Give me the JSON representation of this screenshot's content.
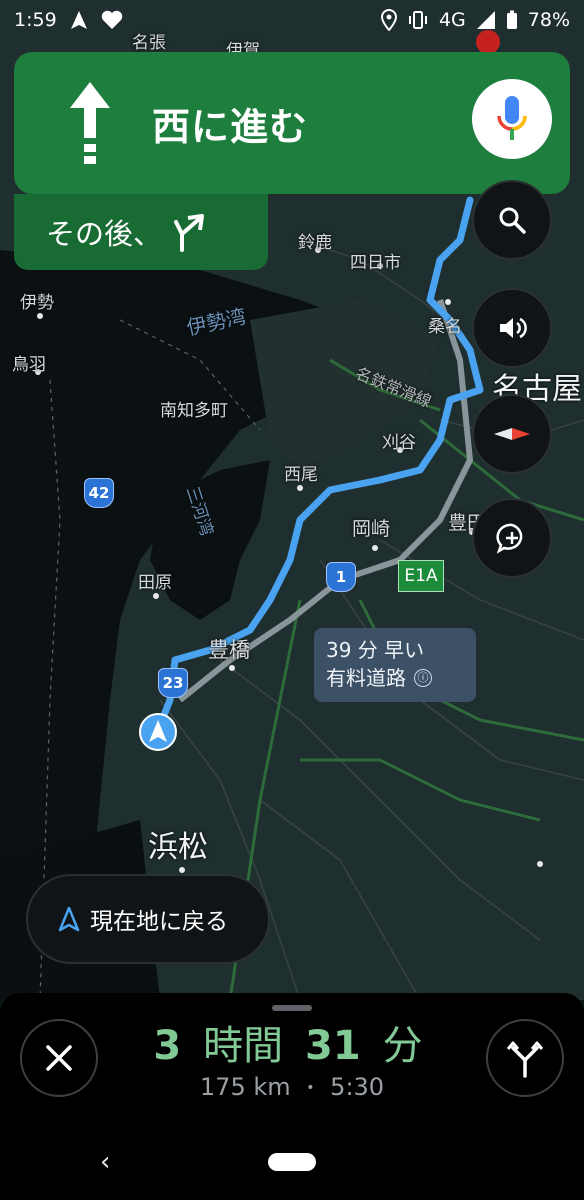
{
  "status_bar": {
    "time": "1:59",
    "network": "4G",
    "battery": "78%"
  },
  "nav": {
    "instruction": "西に進む",
    "then_label": "その後、",
    "colors": {
      "primary": "#1e7e3e",
      "secondary": "#186b33",
      "route": "#4aa3f0"
    }
  },
  "map": {
    "labels": {
      "nabari": "名張",
      "iga": "伊賀",
      "suzuka": "鈴鹿",
      "yokkaichi": "四日市",
      "ise": "伊勢",
      "kuwana": "桑名",
      "toba": "鳥羽",
      "ise_bay": "伊勢湾",
      "nagoya": "名古屋",
      "meitetsu_line": "名鉄常滑線",
      "minamichita": "南知多町",
      "kariya": "刈谷",
      "nishio": "西尾",
      "okazaki": "岡崎",
      "toyota": "豊田",
      "mikawa_bay": "三河湾",
      "tahara": "田原",
      "toyohashi": "豊橋",
      "hamamatsu": "浜松"
    },
    "shields": {
      "route42": "42",
      "route1": "1",
      "route23": "23",
      "expressway": "E1A"
    },
    "callout": {
      "line1": "39 分 早い",
      "line2": "有料道路"
    }
  },
  "recenter": {
    "label": "現在地に戻る"
  },
  "trip": {
    "hours": "3",
    "hours_unit": "時間",
    "minutes": "31",
    "minutes_unit": "分",
    "distance": "175 km",
    "separator": "•",
    "arrival": "5:30"
  }
}
